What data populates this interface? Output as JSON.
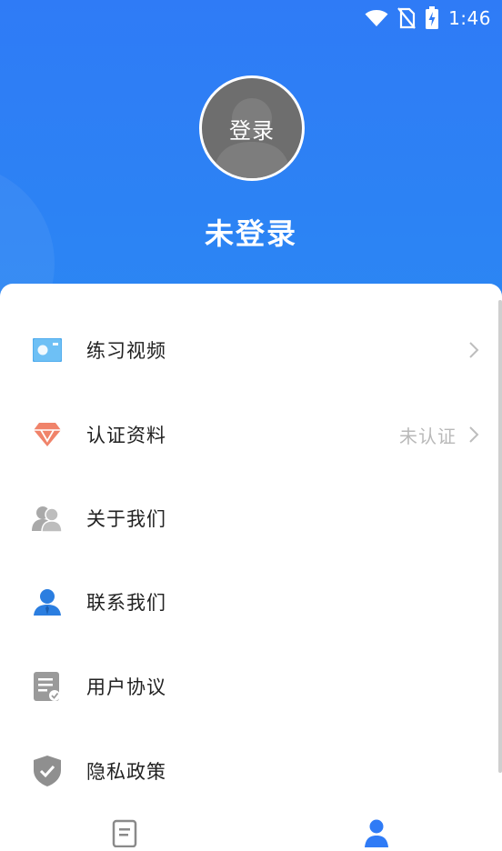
{
  "status_bar": {
    "time": "1:46",
    "icons": [
      "wifi-icon",
      "no-sim-icon",
      "battery-charging-icon"
    ]
  },
  "profile": {
    "avatar_label": "登录",
    "username": "未登录"
  },
  "menu": [
    {
      "label": "练习视频",
      "icon": "video-card-icon",
      "chevron": true
    },
    {
      "label": "认证资料",
      "icon": "diamond-icon",
      "status": "未认证",
      "chevron": true
    },
    {
      "label": "关于我们",
      "icon": "users-icon"
    },
    {
      "label": "联系我们",
      "icon": "contact-person-icon"
    },
    {
      "label": "用户协议",
      "icon": "document-check-icon"
    },
    {
      "label": "隐私政策",
      "icon": "shield-check-icon"
    }
  ],
  "tab_bar": {
    "tabs": [
      {
        "icon": "document-list-icon",
        "active": false
      },
      {
        "icon": "person-icon",
        "active": true
      }
    ],
    "active_color": "#2f7bf6",
    "inactive_color": "#8a8a8a"
  },
  "colors": {
    "header_blue": "#2f7bf6",
    "text": "#222222",
    "muted": "#b9b9b9",
    "diamond": "#f0836a"
  }
}
